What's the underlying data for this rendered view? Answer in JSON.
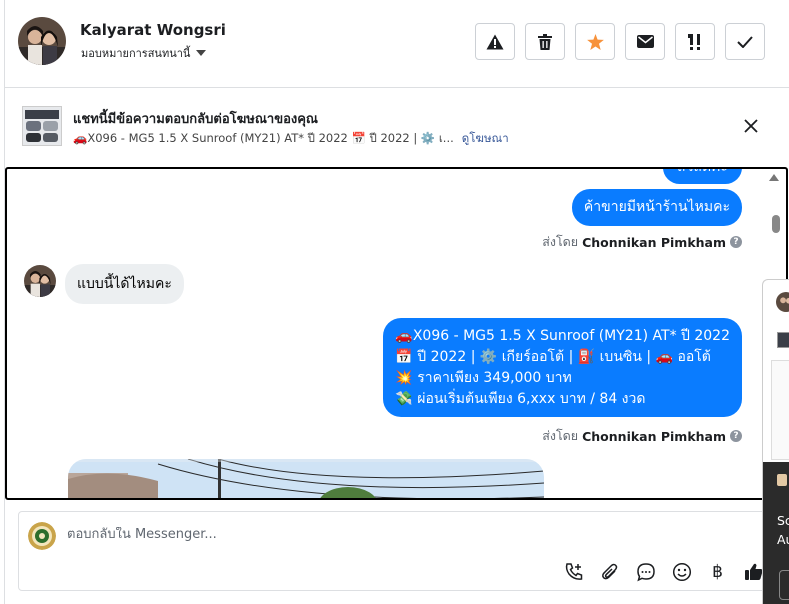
{
  "header": {
    "name": "Kalyarat Wongsri",
    "assign_label": "มอบหมายการสนทนานี้",
    "actions": [
      {
        "name": "report-button",
        "icon": "warning-icon"
      },
      {
        "name": "delete-button",
        "icon": "trash-icon"
      },
      {
        "name": "star-button",
        "icon": "star-icon"
      },
      {
        "name": "mail-button",
        "icon": "envelope-icon"
      },
      {
        "name": "priority-button",
        "icon": "priority-icon"
      },
      {
        "name": "done-button",
        "icon": "check-icon"
      }
    ]
  },
  "ad": {
    "title": "แชทนี้มีข้อความตอบกลับต่อโฆษณาของคุณ",
    "subtitle": "🚗X096 - MG5 1.5 X Sunroof (MY21) AT* ปี 2022 📅 ปี 2022 | ⚙️ เ...",
    "link": "ดูโฆษณา"
  },
  "messages": {
    "top_partial": "สวัสดีค่ะ",
    "out1": "ค้าขายมีหน้าร้านไหมคะ",
    "sent_by_prefix": "ส่งโดย",
    "sent_by_name": "Chonnikan Pimkham",
    "in1": "แบบนี้ได้ไหมคะ",
    "out2_lines": [
      "🚗X096 -  MG5 1.5 X Sunroof (MY21) AT* ปี 2022",
      "📅 ปี 2022 | ⚙️ เกียร์ออโต้ | ⛽ เบนซิน | 🚗 ออโต้",
      "💥 ราคาเพียง 349,000 บาท",
      "💸 ผ่อนเริ่มต้นเพียง 6,xxx บาท / 84 งวด"
    ]
  },
  "composer": {
    "placeholder": "ตอบกลับใน Messenger...",
    "tools": [
      "call-icon",
      "attachment-icon",
      "chat-bubble-icon",
      "emoji-icon",
      "baht-icon",
      "thumbs-up-icon"
    ],
    "baht_symbol": "฿"
  },
  "side_panel": {
    "text1": "Sc",
    "text2": "Au"
  },
  "colors": {
    "accent": "#0a7cff",
    "star": "#f7923b",
    "link": "#385898"
  }
}
